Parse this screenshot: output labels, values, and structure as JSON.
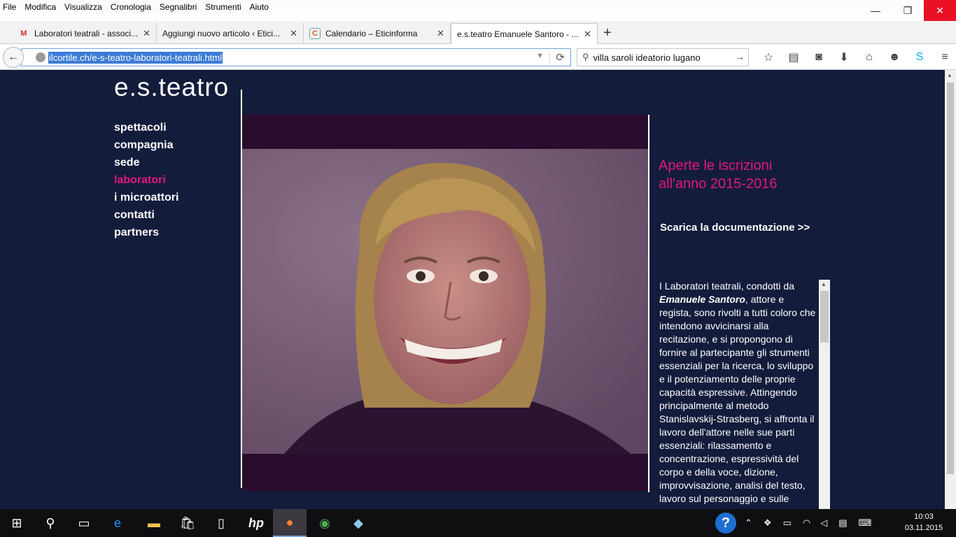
{
  "menubar": {
    "items": [
      "File",
      "Modifica",
      "Visualizza",
      "Cronologia",
      "Segnalibri",
      "Strumenti",
      "Aiuto"
    ]
  },
  "window_controls": {
    "minimize": "—",
    "maximize": "❐",
    "close": "✕"
  },
  "tabs": [
    {
      "title": "Laboratori teatrali - associ...",
      "favicon": "M",
      "favicon_color": "#d93025"
    },
    {
      "title": "Aggiungi nuovo articolo ‹ Etici...",
      "favicon": "",
      "favicon_color": "#888888"
    },
    {
      "title": "Calendario – Eticinforma",
      "favicon": "C",
      "favicon_color": "#e2572c"
    },
    {
      "title": "e.s.teatro Emanuele Santoro - ...",
      "favicon": "",
      "favicon_color": "#888888",
      "active": true
    }
  ],
  "new_tab": "+",
  "navbar": {
    "url": "ilcortile.ch/e-s-teatro-laboratori-teatrali.html",
    "search_query": "villa saroli ideatorio lugano"
  },
  "toolbar_icons": [
    "star-icon",
    "reading-list-icon",
    "pocket-icon",
    "download-icon",
    "home-icon",
    "chat-icon",
    "skype-icon",
    "menu-icon"
  ],
  "site": {
    "logo": "e.s.teatro",
    "nav": [
      {
        "label": "spettacoli"
      },
      {
        "label": "compagnia"
      },
      {
        "label": "sede"
      },
      {
        "label": "laboratori",
        "active": true
      },
      {
        "label": "i microattori"
      },
      {
        "label": "contatti"
      },
      {
        "label": "partners"
      }
    ],
    "headline_line1": "Aperte le iscrizioni",
    "headline_line2": "all'anno 2015-2016",
    "doc_link": "Scarica la documentazione >>",
    "body_intro": "I Laboratori teatrali, condotti da ",
    "body_name": "Emanuele Santoro",
    "body_rest": ", attore e regista, sono rivolti a tutti coloro che intendono avvicinarsi alla recitazione, e si propongono di fornire al partecipante gli strumenti essenziali per la ricerca, lo sviluppo e il potenziamento delle proprie capacità espressive. Attingendo principalmente al metodo Stanislavskij-Strasberg, si affronta il lavoro dell'attore nelle sue parti essenziali: rilassamento e concentrazione, espressività del corpo e della voce, dizione, improvvisazione, analisi del testo, lavoro sul personaggio e sulle",
    "accent_color": "#e0197a",
    "background_color": "#141c3c"
  },
  "taskbar": {
    "time": "10:03",
    "date": "03.11.2015"
  }
}
